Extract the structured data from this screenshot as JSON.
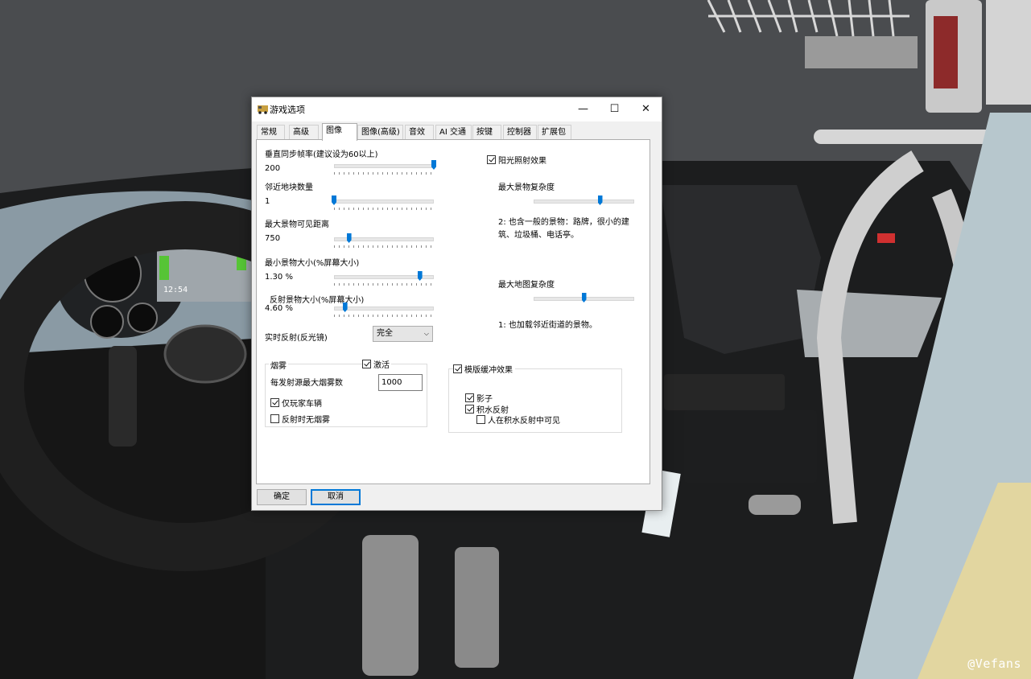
{
  "watermark": "@Vefans",
  "dashboard": {
    "clock": "12:54"
  },
  "dialog": {
    "title": "游戏选项",
    "window_controls": {
      "minimize": "—",
      "maximize": "☐",
      "close": "✕"
    },
    "tabs": [
      {
        "label": "常规"
      },
      {
        "label": "高级"
      },
      {
        "label": "图像"
      },
      {
        "label": "图像(高级)"
      },
      {
        "label": "音效"
      },
      {
        "label": "AI 交通"
      },
      {
        "label": "按键"
      },
      {
        "label": "控制器"
      },
      {
        "label": "扩展包"
      }
    ],
    "active_tab": "图像",
    "left": {
      "vsync": {
        "label": "垂直同步帧率(建议设为60以上)",
        "value": "200",
        "level": 1.0
      },
      "nearby_tiles": {
        "label": "邻近地块数量",
        "value": "1",
        "level": 0.0
      },
      "max_object_distance": {
        "label": "最大景物可见距离",
        "value": "750",
        "level": 0.15
      },
      "min_object_size": {
        "label": "最小景物大小(%屏幕大小)",
        "value": "1.30 %",
        "level": 0.86
      },
      "reflection_object_size": {
        "label": "反射景物大小(%屏幕大小)",
        "value": "4.60 %",
        "level": 0.11
      },
      "realtime_reflection": {
        "label": "实时反射(反光镜)",
        "value": "完全",
        "arrow": "⌵"
      }
    },
    "fog": {
      "group_title": "烟雾",
      "activate": {
        "label": "激活",
        "checked": true
      },
      "max_fog_label": "每发射源最大烟雾数",
      "max_fog_value": "1000",
      "player_only": {
        "label": "仅玩家车辆",
        "checked": true
      },
      "no_fog_in_reflection": {
        "label": "反射时无烟雾",
        "checked": false
      }
    },
    "right": {
      "sunlight": {
        "label": "阳光照射效果",
        "checked": true
      },
      "scenery_complexity": {
        "label": "最大景物复杂度",
        "level": 0.66,
        "description": "2: 也含一般的景物：路牌，很小的建筑、垃圾桶、电话亭。"
      },
      "map_complexity": {
        "label": "最大地图复杂度",
        "level": 0.5,
        "description": "1: 也加载邻近街道的景物。"
      }
    },
    "stencil": {
      "label": "模版缓冲效果",
      "checked": true,
      "shadows": {
        "label": "影子",
        "checked": true
      },
      "water_reflection": {
        "label": "积水反射",
        "checked": true
      },
      "people_in_reflection": {
        "label": "人在积水反射中可见",
        "checked": false
      }
    },
    "buttons": {
      "ok": "确定",
      "cancel": "取消"
    }
  }
}
